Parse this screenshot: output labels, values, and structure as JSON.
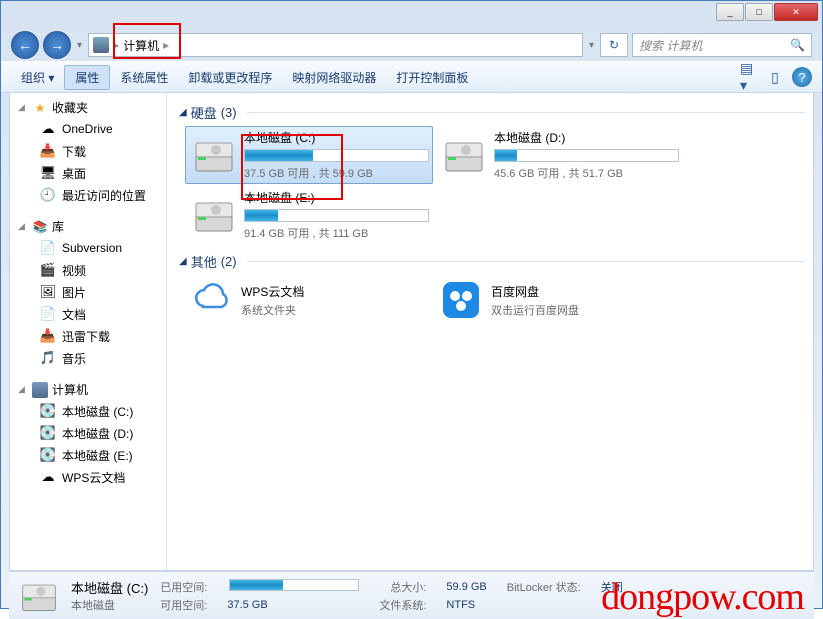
{
  "titlebar": {
    "min": "_",
    "max": "□",
    "close": "✕"
  },
  "nav": {
    "breadcrumb": "计算机",
    "sep": "▸",
    "refresh": "↻",
    "search_placeholder": "搜索 计算机"
  },
  "toolbar": {
    "organize": "组织 ▾",
    "properties": "属性",
    "sys_properties": "系统属性",
    "uninstall": "卸载或更改程序",
    "map_drive": "映射网络驱动器",
    "control_panel": "打开控制面板"
  },
  "sidebar": {
    "favorites": {
      "header": "收藏夹",
      "items": [
        "OneDrive",
        "下载",
        "桌面",
        "最近访问的位置"
      ]
    },
    "library": {
      "header": "库",
      "items": [
        "Subversion",
        "视频",
        "图片",
        "文档",
        "迅雷下载",
        "音乐"
      ]
    },
    "computer": {
      "header": "计算机",
      "items": [
        "本地磁盘 (C:)",
        "本地磁盘 (D:)",
        "本地磁盘 (E:)",
        "WPS云文档"
      ]
    }
  },
  "sections": {
    "hdd": {
      "label": "硬盘",
      "count": "(3)"
    },
    "other": {
      "label": "其他",
      "count": "(2)"
    }
  },
  "drives": [
    {
      "name": "本地磁盘 (C:)",
      "stats": "37.5 GB 可用 , 共 59.9 GB",
      "fill_pct": 37
    },
    {
      "name": "本地磁盘 (D:)",
      "stats": "45.6 GB 可用 , 共 51.7 GB",
      "fill_pct": 12
    },
    {
      "name": "本地磁盘 (E:)",
      "stats": "91.4 GB 可用 , 共 111 GB",
      "fill_pct": 18
    }
  ],
  "others": [
    {
      "name": "WPS云文档",
      "desc": "系统文件夹"
    },
    {
      "name": "百度网盘",
      "desc": "双击运行百度网盘"
    }
  ],
  "status": {
    "title": "本地磁盘 (C:)",
    "subtitle": "本地磁盘",
    "used_label": "已用空间:",
    "free_label": "可用空间:",
    "free_val": "37.5 GB",
    "total_label": "总大小:",
    "total_val": "59.9 GB",
    "fs_label": "文件系统:",
    "fs_val": "NTFS",
    "bitlocker_label": "BitLocker 状态:",
    "bitlocker_val": "关闭"
  },
  "watermark": "dongpow.com"
}
